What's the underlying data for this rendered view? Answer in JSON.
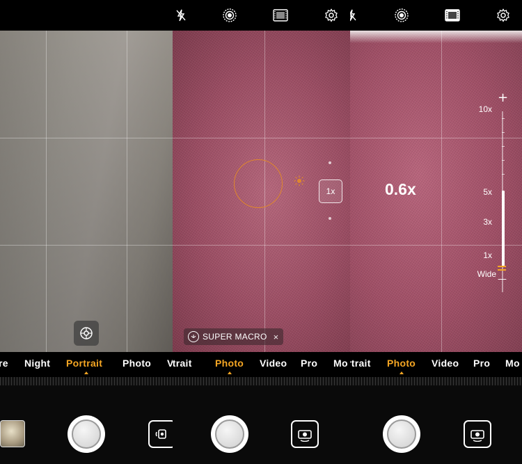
{
  "panels": [
    {
      "modes": [
        "re",
        "Night",
        "Portrait",
        "Photo",
        "V"
      ],
      "active_mode": "Portrait",
      "top_icons": [],
      "viewfinder": {
        "controls": [
          "bokeh-aperture-icon"
        ]
      },
      "bottom": {
        "left": "gallery-thumbnail",
        "center": "shutter-button",
        "right": "switch-camera-button"
      }
    },
    {
      "modes": [
        "rtrait",
        "Photo",
        "Video",
        "Pro",
        "Mo"
      ],
      "active_mode": "Photo",
      "top_icons": [
        "flash-off-icon",
        "ai-lens-icon",
        "film-filter-icon",
        "gear-icon"
      ],
      "viewfinder": {
        "zoom_button_label": "1x",
        "super_macro_label": "SUPER MACRO"
      },
      "bottom": {
        "center": "shutter-button",
        "right": "switch-camera-button"
      }
    },
    {
      "modes": [
        "rtrait",
        "Photo",
        "Video",
        "Pro",
        "Mo"
      ],
      "active_mode": "Photo",
      "top_icons": [
        "flash-off-icon",
        "ai-lens-icon",
        "film-filter-icon",
        "gear-icon"
      ],
      "viewfinder": {
        "zoom_readout": "0.6x",
        "zoom_labels": [
          "10x",
          "5x",
          "3x",
          "1x",
          "Wide"
        ],
        "zoom_plus": "+",
        "zoom_minus": "—"
      },
      "bottom": {
        "center": "shutter-button",
        "right": "switch-camera-button"
      }
    }
  ],
  "colors": {
    "accent": "#f5a623",
    "focus_ring": "#e0872c"
  }
}
